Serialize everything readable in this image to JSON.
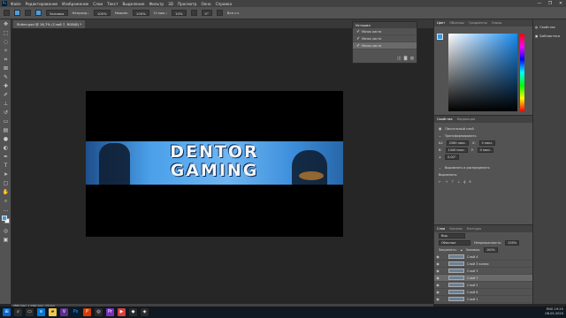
{
  "menubar": {
    "app_icon": "Ps",
    "items": [
      "Файл",
      "Редактирование",
      "Изображение",
      "Слои",
      "Текст",
      "Выделение",
      "Фильтр",
      "3D",
      "Просмотр",
      "Окно",
      "Справка"
    ],
    "window_controls": [
      "—",
      "❐",
      "✕"
    ]
  },
  "options_bar": {
    "mode_label": "Заливка",
    "opacity_label": "Непрозр.:",
    "opacity_value": "100%",
    "flow_label": "Нажим:",
    "flow_value": "100%",
    "smooth_label": "Сглаж.:",
    "smooth_value": "10%",
    "angle_value": "0°",
    "all_layers_label": "Все сл."
  },
  "document": {
    "tab_title": "Shikm.psd @ 16,7% (Слой 7, RGB/8) *"
  },
  "banner": {
    "line1": "DENTOR",
    "line2": "GAMING"
  },
  "history": {
    "title": "История",
    "items": [
      "Мазок кисти",
      "Мазок кисти",
      "Мазок кисти"
    ]
  },
  "color_panel": {
    "tabs": [
      "Цвет",
      "Образцы",
      "Градиенты",
      "Узоры"
    ],
    "foreground": "#2e9ef2",
    "background": "#ffffff"
  },
  "right_panel": {
    "items": [
      "Свойства",
      "Библиотеки"
    ]
  },
  "properties": {
    "tabs": [
      "Свойства",
      "Коррекция"
    ],
    "kind": "Пиксельный слой",
    "transform_title": "Трансформировать",
    "w_label": "Ш:",
    "w_value": "2560 пикс.",
    "h_label": "В:",
    "h_value": "1440 пикс.",
    "x_label": "X:",
    "x_value": "0 пикс.",
    "y_label": "Y:",
    "y_value": "0 пикс.",
    "angle_value": "0,00°",
    "align_title": "Выровнять и распределить",
    "align_sub": "Выровнять:"
  },
  "layers": {
    "tabs": [
      "Слои",
      "Каналы",
      "Контуры"
    ],
    "kind_filter": "Вид",
    "blend_mode": "Обычные",
    "opacity_label": "Непрозрачность:",
    "opacity_value": "100%",
    "lock_label": "Закрепить:",
    "fill_label": "Заливка:",
    "fill_value": "100%",
    "rows": [
      {
        "name": "Слой 4"
      },
      {
        "name": "Слой 3 копия"
      },
      {
        "name": "Слой 3"
      },
      {
        "name": "Слой 7"
      },
      {
        "name": "Слой 2"
      },
      {
        "name": "Слой 6"
      },
      {
        "name": "Слой 1"
      }
    ]
  },
  "status": {
    "text": "2560 пикс. x 1440 пикс. (72 ppi)"
  },
  "taskbar": {
    "time": "19:25",
    "date": "08.05.2020",
    "lang": "ENG"
  }
}
